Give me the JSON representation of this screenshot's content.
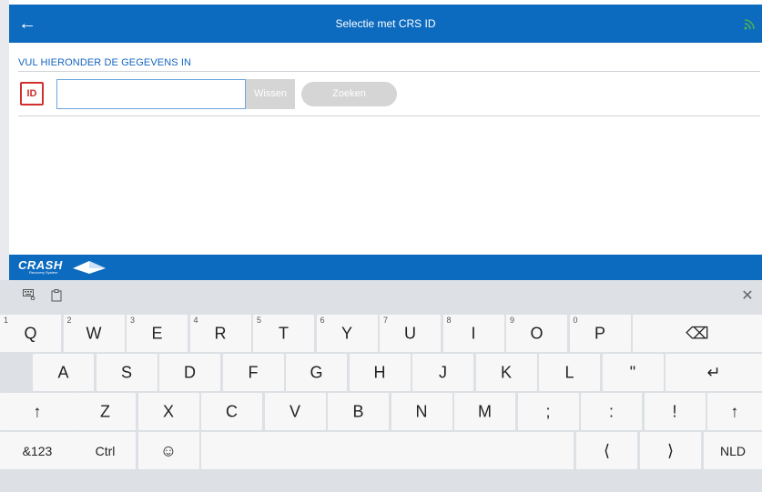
{
  "topbar": {
    "title": "Selectie met CRS ID",
    "back_icon": "arrow-left-icon",
    "signal_icon": "wifi-signal-icon",
    "signal_color": "#4caf50"
  },
  "form": {
    "section_label": "VUL HIERONDER DE GEGEVENS IN",
    "id_badge": "ID",
    "id_input_value": "",
    "wissen_label": "Wissen",
    "zoeken_label": "Zoeken"
  },
  "footer": {
    "logo_text": "Crash",
    "logo_sub": "Recovery System"
  },
  "keyboard": {
    "toolbar_icons": [
      "keyboard-settings-icon",
      "clipboard-icon"
    ],
    "close_icon": "close-icon",
    "row1": [
      {
        "label": "Q",
        "num": "1"
      },
      {
        "label": "W",
        "num": "2"
      },
      {
        "label": "E",
        "num": "3"
      },
      {
        "label": "R",
        "num": "4"
      },
      {
        "label": "T",
        "num": "5"
      },
      {
        "label": "Y",
        "num": "6"
      },
      {
        "label": "U",
        "num": "7"
      },
      {
        "label": "I",
        "num": "8"
      },
      {
        "label": "O",
        "num": "9"
      },
      {
        "label": "P",
        "num": "0"
      }
    ],
    "row2": [
      "A",
      "S",
      "D",
      "F",
      "G",
      "H",
      "J",
      "K",
      "L",
      "\""
    ],
    "row3": [
      "Z",
      "X",
      "C",
      "V",
      "B",
      "N",
      "M",
      ";",
      ":",
      "!"
    ],
    "backspace_icon": "backspace-icon",
    "enter_icon": "enter-icon",
    "shift_icon": "shift-icon",
    "symbols_label": "&123",
    "ctrl_label": "Ctrl",
    "emoji_icon": "emoji-icon",
    "left_icon": "chevron-left-icon",
    "right_icon": "chevron-right-icon",
    "lang_label": "NLD"
  }
}
